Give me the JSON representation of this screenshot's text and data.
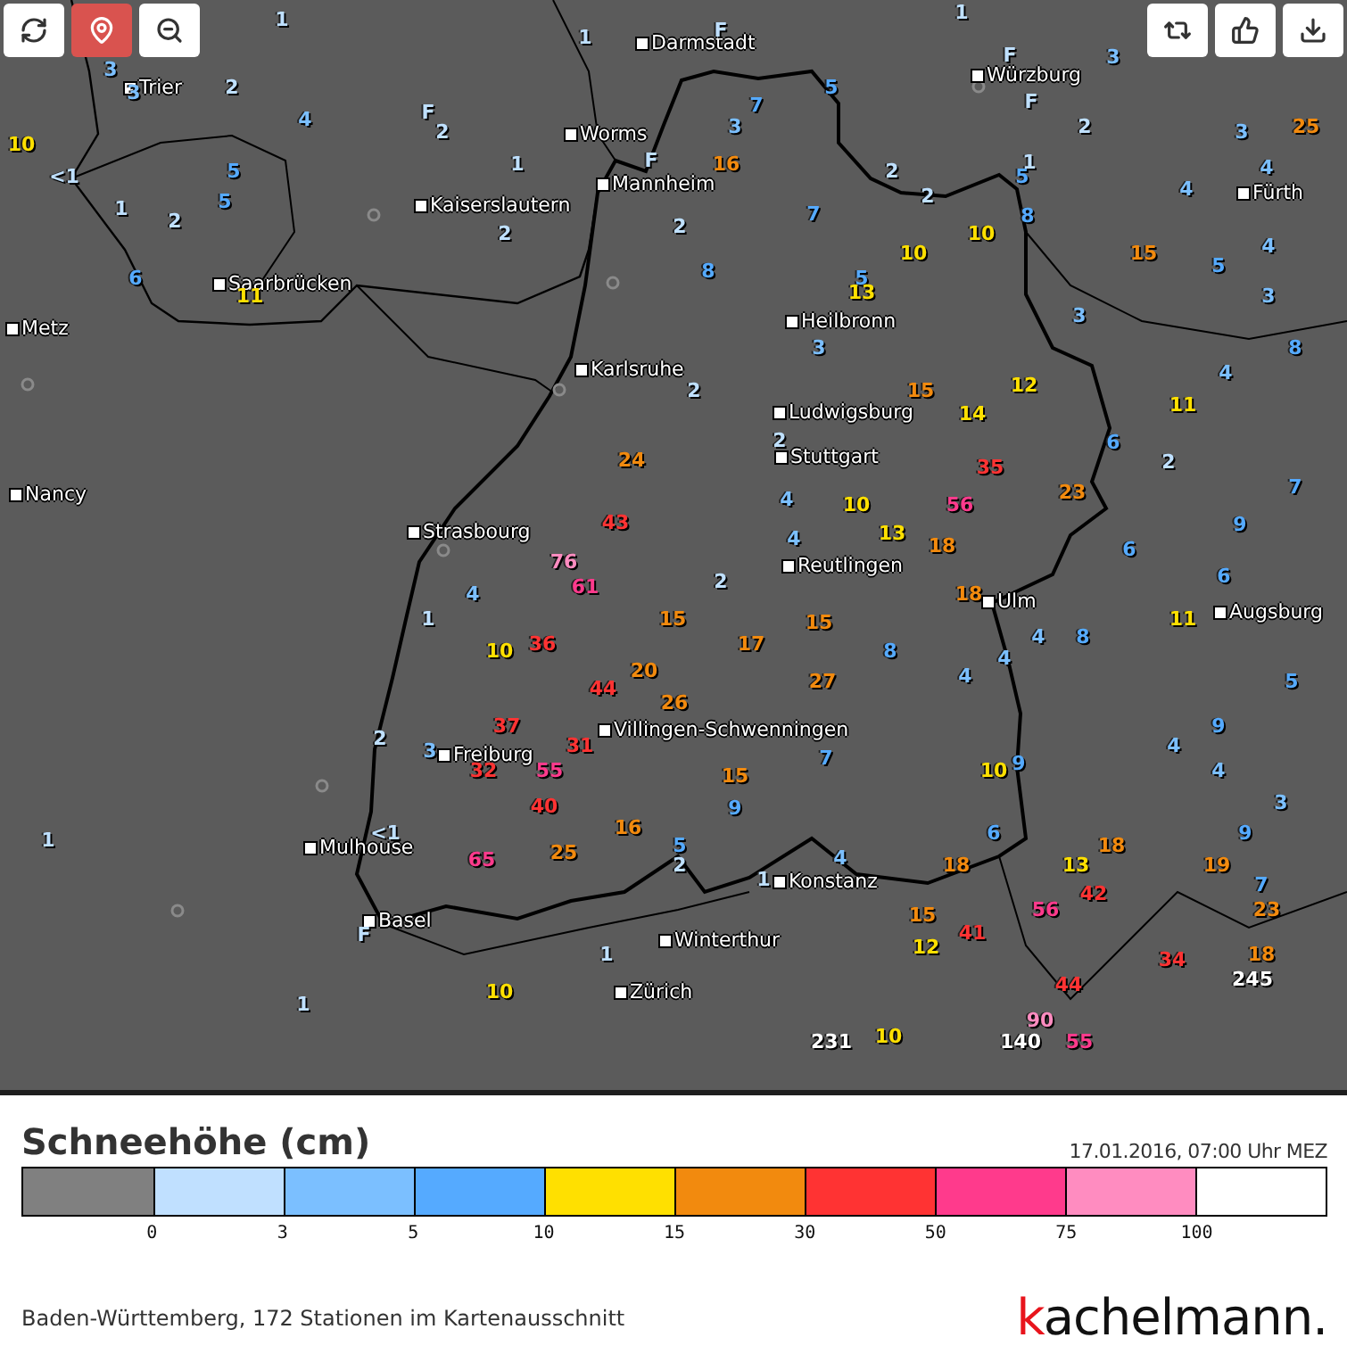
{
  "map": {
    "buttons_left": [
      {
        "kind": "refresh",
        "active": false
      },
      {
        "kind": "location",
        "active": true
      },
      {
        "kind": "zoom-out",
        "active": false
      }
    ],
    "buttons_right": [
      {
        "kind": "share",
        "active": false
      },
      {
        "kind": "like",
        "active": false
      },
      {
        "kind": "download",
        "active": false
      }
    ],
    "cities": [
      {
        "name": "Darmstadt"
      },
      {
        "name": "Würzburg"
      },
      {
        "name": "Trier"
      },
      {
        "name": "Worms"
      },
      {
        "name": "Mannheim"
      },
      {
        "name": "Fürth"
      },
      {
        "name": "Kaiserslautern"
      },
      {
        "name": "Saarbrücken"
      },
      {
        "name": "Metz"
      },
      {
        "name": "Heilbronn"
      },
      {
        "name": "Karlsruhe"
      },
      {
        "name": "Ludwigsburg"
      },
      {
        "name": "Stuttgart"
      },
      {
        "name": "Nancy"
      },
      {
        "name": "Strasbourg"
      },
      {
        "name": "Reutlingen"
      },
      {
        "name": "Ulm"
      },
      {
        "name": "Augsburg"
      },
      {
        "name": "Villingen-Schwenningen"
      },
      {
        "name": "Freiburg"
      },
      {
        "name": "Mulhouse"
      },
      {
        "name": "Konstanz"
      },
      {
        "name": "Basel"
      },
      {
        "name": "Winterthur"
      },
      {
        "name": "Zürich"
      }
    ],
    "stations": [
      {
        "value": "1",
        "color": "#bfe0ff"
      },
      {
        "value": "1",
        "color": "#bfe0ff"
      },
      {
        "value": "F",
        "color": "#bfe0ff"
      },
      {
        "value": "1",
        "color": "#bfe0ff"
      },
      {
        "value": "3",
        "color": "#7bbfff"
      },
      {
        "value": "3",
        "color": "#7bbfff"
      },
      {
        "value": "2",
        "color": "#bfe0ff"
      },
      {
        "value": "4",
        "color": "#7bbfff"
      },
      {
        "value": "F",
        "color": "#bfe0ff"
      },
      {
        "value": "2",
        "color": "#bfe0ff"
      },
      {
        "value": "10",
        "color": "#ffe000"
      },
      {
        "value": "1",
        "color": "#bfe0ff"
      },
      {
        "value": "F",
        "color": "#bfe0ff"
      },
      {
        "value": "<1",
        "color": "#bfe0ff"
      },
      {
        "value": "5",
        "color": "#55aaff"
      },
      {
        "value": "5",
        "color": "#55aaff"
      },
      {
        "value": "1",
        "color": "#bfe0ff"
      },
      {
        "value": "2",
        "color": "#bfe0ff"
      },
      {
        "value": "2",
        "color": "#bfe0ff"
      },
      {
        "value": "6",
        "color": "#55aaff"
      },
      {
        "value": "11",
        "color": "#ffe000"
      },
      {
        "value": "F",
        "color": "#bfe0ff"
      },
      {
        "value": "3",
        "color": "#7bbfff"
      },
      {
        "value": "5",
        "color": "#55aaff"
      },
      {
        "value": "7",
        "color": "#55aaff"
      },
      {
        "value": "3",
        "color": "#7bbfff"
      },
      {
        "value": "2",
        "color": "#bfe0ff"
      },
      {
        "value": "3",
        "color": "#7bbfff"
      },
      {
        "value": "25",
        "color": "#f28a0e"
      },
      {
        "value": "F",
        "color": "#bfe0ff"
      },
      {
        "value": "16",
        "color": "#f28a0e"
      },
      {
        "value": "2",
        "color": "#bfe0ff"
      },
      {
        "value": "1",
        "color": "#bfe0ff"
      },
      {
        "value": "5",
        "color": "#55aaff"
      },
      {
        "value": "2",
        "color": "#bfe0ff"
      },
      {
        "value": "4",
        "color": "#7bbfff"
      },
      {
        "value": "4",
        "color": "#7bbfff"
      },
      {
        "value": "7",
        "color": "#55aaff"
      },
      {
        "value": "8",
        "color": "#55aaff"
      },
      {
        "value": "10",
        "color": "#ffe000"
      },
      {
        "value": "10",
        "color": "#ffe000"
      },
      {
        "value": "15",
        "color": "#f28a0e"
      },
      {
        "value": "4",
        "color": "#7bbfff"
      },
      {
        "value": "5",
        "color": "#55aaff"
      },
      {
        "value": "5",
        "color": "#55aaff"
      },
      {
        "value": "3",
        "color": "#7bbfff"
      },
      {
        "value": "2",
        "color": "#bfe0ff"
      },
      {
        "value": "8",
        "color": "#55aaff"
      },
      {
        "value": "13",
        "color": "#ffe000"
      },
      {
        "value": "3",
        "color": "#7bbfff"
      },
      {
        "value": "3",
        "color": "#7bbfff"
      },
      {
        "value": "8",
        "color": "#55aaff"
      },
      {
        "value": "2",
        "color": "#bfe0ff"
      },
      {
        "value": "4",
        "color": "#7bbfff"
      },
      {
        "value": "12",
        "color": "#ffe000"
      },
      {
        "value": "15",
        "color": "#f28a0e"
      },
      {
        "value": "14",
        "color": "#ffe000"
      },
      {
        "value": "11",
        "color": "#ffe000"
      },
      {
        "value": "2",
        "color": "#bfe0ff"
      },
      {
        "value": "6",
        "color": "#55aaff"
      },
      {
        "value": "35",
        "color": "#ff3333"
      },
      {
        "value": "2",
        "color": "#bfe0ff"
      },
      {
        "value": "23",
        "color": "#f28a0e"
      },
      {
        "value": "7",
        "color": "#55aaff"
      },
      {
        "value": "4",
        "color": "#7bbfff"
      },
      {
        "value": "10",
        "color": "#ffe000"
      },
      {
        "value": "56",
        "color": "#ff3a8c"
      },
      {
        "value": "9",
        "color": "#55aaff"
      },
      {
        "value": "18",
        "color": "#f28a0e"
      },
      {
        "value": "24",
        "color": "#f28a0e"
      },
      {
        "value": "43",
        "color": "#ff3333"
      },
      {
        "value": "2",
        "color": "#bfe0ff"
      },
      {
        "value": "15",
        "color": "#f28a0e"
      },
      {
        "value": "26",
        "color": "#f28a0e"
      },
      {
        "value": "5",
        "color": "#55aaff"
      },
      {
        "value": "2",
        "color": "#bfe0ff"
      },
      {
        "value": "6",
        "color": "#55aaff"
      },
      {
        "value": "4",
        "color": "#7bbfff"
      },
      {
        "value": "13",
        "color": "#ffe000"
      },
      {
        "value": "6",
        "color": "#55aaff"
      },
      {
        "value": "18",
        "color": "#f28a0e"
      },
      {
        "value": "11",
        "color": "#ffe000"
      },
      {
        "value": "4",
        "color": "#7bbfff"
      },
      {
        "value": "8",
        "color": "#55aaff"
      },
      {
        "value": "15",
        "color": "#f28a0e"
      },
      {
        "value": "17",
        "color": "#f28a0e"
      },
      {
        "value": "8",
        "color": "#55aaff"
      },
      {
        "value": "4",
        "color": "#7bbfff"
      },
      {
        "value": "27",
        "color": "#f28a0e"
      },
      {
        "value": "4",
        "color": "#7bbfff"
      },
      {
        "value": "5",
        "color": "#55aaff"
      },
      {
        "value": "9",
        "color": "#55aaff"
      },
      {
        "value": "7",
        "color": "#55aaff"
      },
      {
        "value": "4",
        "color": "#7bbfff"
      },
      {
        "value": "10",
        "color": "#ffe000"
      },
      {
        "value": "9",
        "color": "#55aaff"
      },
      {
        "value": "15",
        "color": "#f28a0e"
      },
      {
        "value": "4",
        "color": "#7bbfff"
      },
      {
        "value": "9",
        "color": "#55aaff"
      },
      {
        "value": "3",
        "color": "#7bbfff"
      },
      {
        "value": "6",
        "color": "#55aaff"
      },
      {
        "value": "9",
        "color": "#55aaff"
      },
      {
        "value": "18",
        "color": "#f28a0e"
      },
      {
        "value": "18",
        "color": "#f28a0e"
      },
      {
        "value": "13",
        "color": "#ffe000"
      },
      {
        "value": "19",
        "color": "#f28a0e"
      },
      {
        "value": "4",
        "color": "#7bbfff"
      },
      {
        "value": "1",
        "color": "#bfe0ff"
      },
      {
        "value": "7",
        "color": "#55aaff"
      },
      {
        "value": "42",
        "color": "#ff3333"
      },
      {
        "value": "15",
        "color": "#f28a0e"
      },
      {
        "value": "56",
        "color": "#ff3a8c"
      },
      {
        "value": "23",
        "color": "#f28a0e"
      },
      {
        "value": "41",
        "color": "#ff3333"
      },
      {
        "value": "12",
        "color": "#ffe000"
      },
      {
        "value": "34",
        "color": "#ff3333"
      },
      {
        "value": "18",
        "color": "#f28a0e"
      },
      {
        "value": "44",
        "color": "#ff3333"
      },
      {
        "value": "245",
        "color": "#ffffff"
      },
      {
        "value": "90",
        "color": "#ff8cc0"
      },
      {
        "value": "231",
        "color": "#ffffff"
      },
      {
        "value": "10",
        "color": "#ffe000"
      },
      {
        "value": "140",
        "color": "#ffffff"
      },
      {
        "value": "55",
        "color": "#ff3a8c"
      },
      {
        "value": "76",
        "color": "#ff8cc0"
      },
      {
        "value": "61",
        "color": "#ff3a8c"
      },
      {
        "value": "4",
        "color": "#7bbfff"
      },
      {
        "value": "1",
        "color": "#bfe0ff"
      },
      {
        "value": "10",
        "color": "#ffe000"
      },
      {
        "value": "36",
        "color": "#ff3333"
      },
      {
        "value": "20",
        "color": "#f28a0e"
      },
      {
        "value": "44",
        "color": "#ff3333"
      },
      {
        "value": "2",
        "color": "#bfe0ff"
      },
      {
        "value": "37",
        "color": "#ff3333"
      },
      {
        "value": "3",
        "color": "#7bbfff"
      },
      {
        "value": "31",
        "color": "#ff3333"
      },
      {
        "value": "32",
        "color": "#ff3333"
      },
      {
        "value": "55",
        "color": "#ff3a8c"
      },
      {
        "value": "40",
        "color": "#ff3333"
      },
      {
        "value": "<1",
        "color": "#bfe0ff"
      },
      {
        "value": "16",
        "color": "#f28a0e"
      },
      {
        "value": "65",
        "color": "#ff3a8c"
      },
      {
        "value": "25",
        "color": "#f28a0e"
      },
      {
        "value": "F",
        "color": "#bfe0ff"
      },
      {
        "value": "1",
        "color": "#bfe0ff"
      },
      {
        "value": "1",
        "color": "#bfe0ff"
      },
      {
        "value": "1",
        "color": "#bfe0ff"
      },
      {
        "value": "10",
        "color": "#ffe000"
      }
    ]
  },
  "legend": {
    "title": "Schneehöhe (cm)",
    "timestamp": "17.01.2016, 07:00 Uhr MEZ",
    "segments": [
      {
        "color": "#808080"
      },
      {
        "color": "#c0e0ff"
      },
      {
        "color": "#7bbfff"
      },
      {
        "color": "#55aaff"
      },
      {
        "color": "#ffe000"
      },
      {
        "color": "#f28a0e"
      },
      {
        "color": "#ff3333"
      },
      {
        "color": "#ff3a8c"
      },
      {
        "color": "#ff8cc0"
      },
      {
        "color": "#ffffff"
      }
    ],
    "ticks": [
      "0",
      "3",
      "5",
      "10",
      "15",
      "30",
      "50",
      "75",
      "100"
    ]
  },
  "footer": {
    "caption": "Baden-Württemberg, 172 Stationen im Kartenausschnitt",
    "logo": "kachelmann."
  }
}
